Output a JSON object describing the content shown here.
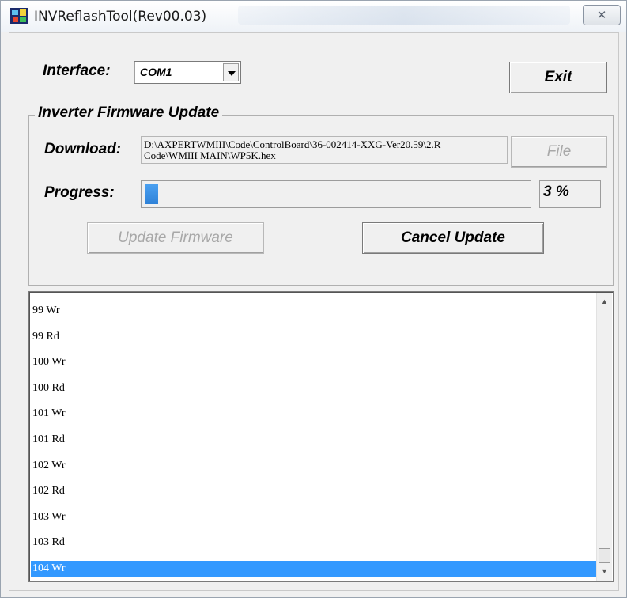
{
  "window": {
    "title": "INVReflashTool(Rev00.03)",
    "close_glyph": "✕"
  },
  "interface": {
    "label": "Interface:",
    "selected": "COM1"
  },
  "exit_label": "Exit",
  "firmware_update": {
    "group_title": "Inverter Firmware Update",
    "download_label": "Download:",
    "file_path_line1": "D:\\AXPERTWMIII\\Code\\ControlBoard\\36-002414-XXG-Ver20.59\\2.R",
    "file_path_line2": "Code\\WMIII MAIN\\WP5K.hex",
    "file_button": "File",
    "progress_label": "Progress:",
    "progress_percent": 3,
    "progress_text": "3 %",
    "update_button": "Update Firmware",
    "cancel_button": "Cancel Update"
  },
  "log": {
    "rows": [
      "99 Wr",
      "99 Rd",
      "100 Wr",
      "100 Rd",
      "101 Wr",
      "101 Rd",
      "102 Wr",
      "102 Rd",
      "103 Wr",
      "103 Rd",
      "104 Wr"
    ],
    "selected_index": 10
  },
  "colors": {
    "progress": "#3390e6",
    "selection": "#3399ff"
  },
  "icons": {
    "app": "app-icon",
    "close": "close-icon",
    "dropdown": "chevron-down-icon",
    "scroll_up": "chevron-up-icon",
    "scroll_down": "chevron-down-icon"
  }
}
